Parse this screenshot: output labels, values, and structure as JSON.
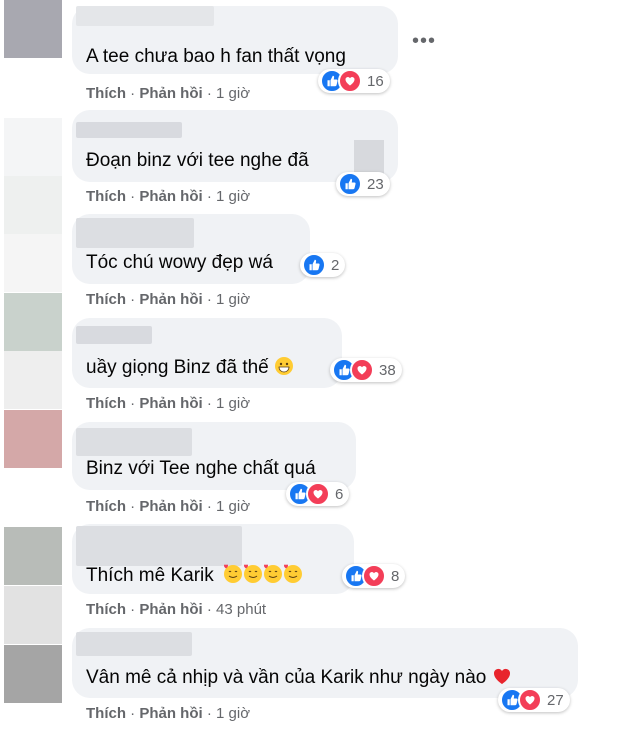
{
  "comments": [
    {
      "text": "A tee chưa bao h fan thất vọng",
      "like": "Thích",
      "reply": "Phản hồi",
      "time": "1 giờ",
      "count": "16"
    },
    {
      "text": "Đoạn binz với tee nghe đã",
      "like": "Thích",
      "reply": "Phản hồi",
      "time": "1 giờ",
      "count": "23"
    },
    {
      "text": "Tóc chú wowy đẹp wá",
      "like": "Thích",
      "reply": "Phản hồi",
      "time": "1 giờ",
      "count": "2"
    },
    {
      "text": "uầy giọng Binz đã thế",
      "like": "Thích",
      "reply": "Phản hồi",
      "time": "1 giờ",
      "count": "38"
    },
    {
      "text": "Binz với Tee nghe chất quá",
      "like": "Thích",
      "reply": "Phản hồi",
      "time": "1 giờ",
      "count": "6"
    },
    {
      "text": "Thích mê Karik",
      "like": "Thích",
      "reply": "Phản hồi",
      "time": "43 phút",
      "count": "8"
    },
    {
      "text": "Vân mê cả nhịp và vần của Karik như ngày nào",
      "like": "Thích",
      "reply": "Phản hồi",
      "time": "1 giờ",
      "count": "27"
    }
  ],
  "more_label": "•••",
  "icons": {
    "like": "like-reaction-icon",
    "love": "love-reaction-icon",
    "more": "more-options-icon"
  },
  "colors": {
    "like": "#1877f2",
    "love": "#f33e58",
    "bubble": "#f0f2f5",
    "meta": "#65676b"
  }
}
